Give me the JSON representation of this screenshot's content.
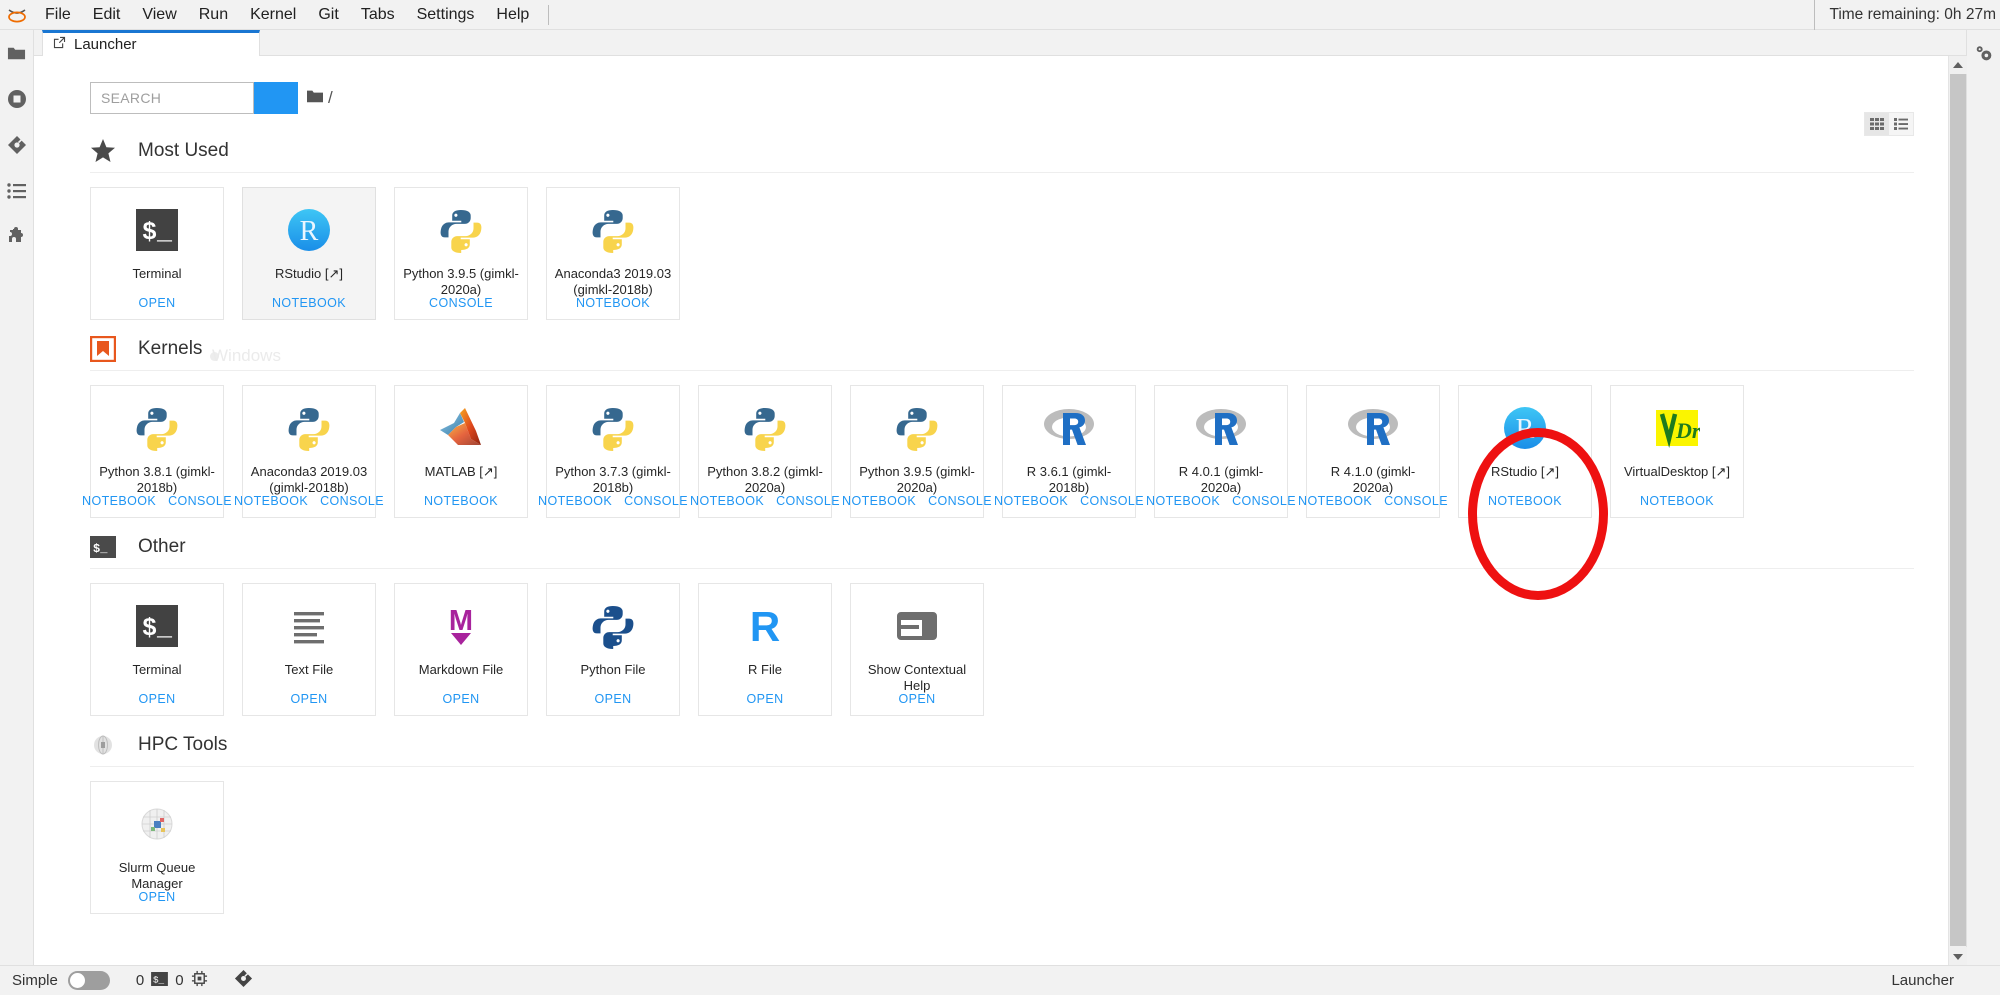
{
  "app": {
    "logo_icon": "jupyter-logo-icon",
    "time_remaining": "Time remaining: 0h 27m",
    "status_right_label": "Launcher"
  },
  "menubar": {
    "items": [
      {
        "label": "File",
        "name": "menu-file"
      },
      {
        "label": "Edit",
        "name": "menu-edit"
      },
      {
        "label": "View",
        "name": "menu-view"
      },
      {
        "label": "Run",
        "name": "menu-run"
      },
      {
        "label": "Kernel",
        "name": "menu-kernel"
      },
      {
        "label": "Git",
        "name": "menu-git"
      },
      {
        "label": "Tabs",
        "name": "menu-tabs"
      },
      {
        "label": "Settings",
        "name": "menu-settings"
      },
      {
        "label": "Help",
        "name": "menu-help"
      }
    ]
  },
  "left_sidebar": {
    "items": [
      {
        "icon": "folder-icon",
        "name": "sidebar-file-browser"
      },
      {
        "icon": "stop-circle-icon",
        "name": "sidebar-running-terminals"
      },
      {
        "icon": "git-diamond-icon",
        "name": "sidebar-git"
      },
      {
        "icon": "list-icon",
        "name": "sidebar-table-of-contents"
      },
      {
        "icon": "puzzle-piece-icon",
        "name": "sidebar-extension-manager"
      }
    ]
  },
  "right_sidebar": {
    "items": [
      {
        "icon": "property-inspector-gears-icon",
        "name": "sidebar-property-inspector"
      }
    ]
  },
  "tabbar": {
    "tabs": [
      {
        "label": "Launcher",
        "icon": "launcher-icon",
        "active": true
      }
    ]
  },
  "launcher": {
    "search": {
      "value": "",
      "placeholder": "SEARCH"
    },
    "breadcrumb": {
      "folder_icon": "folder-icon",
      "path": "/"
    },
    "view_toggle": [
      {
        "name": "grid-view-button",
        "icon": "grid-icon",
        "active": true
      },
      {
        "name": "list-view-button",
        "icon": "list-view-icon",
        "active": false
      }
    ],
    "accent_color": "#2196f3",
    "annotation_color": "#ee1111",
    "watermark": "Windows",
    "sections": [
      {
        "title": "Most Used",
        "icon": "star-icon",
        "cards": [
          {
            "label": "Terminal",
            "icon": "terminal-icon",
            "actions": [
              "OPEN"
            ],
            "hovered": false
          },
          {
            "label": "RStudio [↗]",
            "icon": "rstudio-icon",
            "actions": [
              "NOTEBOOK"
            ],
            "hovered": true
          },
          {
            "label": "Python 3.9.5 (gimkl-2020a)",
            "icon": "python-icon",
            "actions": [
              "CONSOLE"
            ],
            "hovered": false
          },
          {
            "label": "Anaconda3 2019.03 (gimkl-2018b)",
            "icon": "python-icon",
            "actions": [
              "NOTEBOOK"
            ],
            "hovered": false
          }
        ]
      },
      {
        "title": "Kernels",
        "icon": "bookmark-icon",
        "cards": [
          {
            "label": "Python 3.8.1 (gimkl-2018b)",
            "icon": "python-icon",
            "actions": [
              "NOTEBOOK",
              "CONSOLE"
            ],
            "hovered": false
          },
          {
            "label": "Anaconda3 2019.03 (gimkl-2018b)",
            "icon": "python-icon",
            "actions": [
              "NOTEBOOK",
              "CONSOLE"
            ],
            "hovered": false
          },
          {
            "label": "MATLAB [↗]",
            "icon": "matlab-icon",
            "actions": [
              "NOTEBOOK"
            ],
            "hovered": false
          },
          {
            "label": "Python 3.7.3 (gimkl-2018b)",
            "icon": "python-icon",
            "actions": [
              "NOTEBOOK",
              "CONSOLE"
            ],
            "hovered": false
          },
          {
            "label": "Python 3.8.2 (gimkl-2020a)",
            "icon": "python-icon",
            "actions": [
              "NOTEBOOK",
              "CONSOLE"
            ],
            "hovered": false
          },
          {
            "label": "Python 3.9.5 (gimkl-2020a)",
            "icon": "python-icon",
            "actions": [
              "NOTEBOOK",
              "CONSOLE"
            ],
            "hovered": false
          },
          {
            "label": "R 3.6.1 (gimkl-2018b)",
            "icon": "r-logo-icon",
            "actions": [
              "NOTEBOOK",
              "CONSOLE"
            ],
            "hovered": false
          },
          {
            "label": "R 4.0.1 (gimkl-2020a)",
            "icon": "r-logo-icon",
            "actions": [
              "NOTEBOOK",
              "CONSOLE"
            ],
            "hovered": false
          },
          {
            "label": "R 4.1.0 (gimkl-2020a)",
            "icon": "r-logo-icon",
            "actions": [
              "NOTEBOOK",
              "CONSOLE"
            ],
            "hovered": false
          },
          {
            "label": "RStudio [↗]",
            "icon": "rstudio-icon",
            "actions": [
              "NOTEBOOK"
            ],
            "hovered": false,
            "annotated": true
          },
          {
            "label": "VirtualDesktop [↗]",
            "icon": "vdi-icon",
            "actions": [
              "NOTEBOOK"
            ],
            "hovered": false
          }
        ]
      },
      {
        "title": "Other",
        "icon": "terminal-small-icon",
        "cards": [
          {
            "label": "Terminal",
            "icon": "terminal-icon",
            "actions": [
              "OPEN"
            ],
            "hovered": false
          },
          {
            "label": "Text File",
            "icon": "text-file-icon",
            "actions": [
              "OPEN"
            ],
            "hovered": false
          },
          {
            "label": "Markdown File",
            "icon": "markdown-icon",
            "actions": [
              "OPEN"
            ],
            "hovered": false
          },
          {
            "label": "Python File",
            "icon": "python-file-icon",
            "actions": [
              "OPEN"
            ],
            "hovered": false
          },
          {
            "label": "R File",
            "icon": "r-file-icon",
            "actions": [
              "OPEN"
            ],
            "hovered": false
          },
          {
            "label": "Show Contextual Help",
            "icon": "contextual-help-icon",
            "actions": [
              "OPEN"
            ],
            "hovered": false
          }
        ]
      },
      {
        "title": "HPC Tools",
        "icon": "hpc-sphere-icon",
        "cards": [
          {
            "label": "Slurm Queue Manager",
            "icon": "slurm-icon",
            "actions": [
              "OPEN"
            ],
            "hovered": false
          }
        ]
      }
    ]
  },
  "statusbar": {
    "simple_label": "Simple",
    "simple_on": false,
    "terminal_count": "0",
    "kernel_count": "0",
    "terminal_icon": "terminal-icon",
    "kernel_icon": "kernel-chip-icon",
    "git_icon": "git-diamond-icon"
  }
}
